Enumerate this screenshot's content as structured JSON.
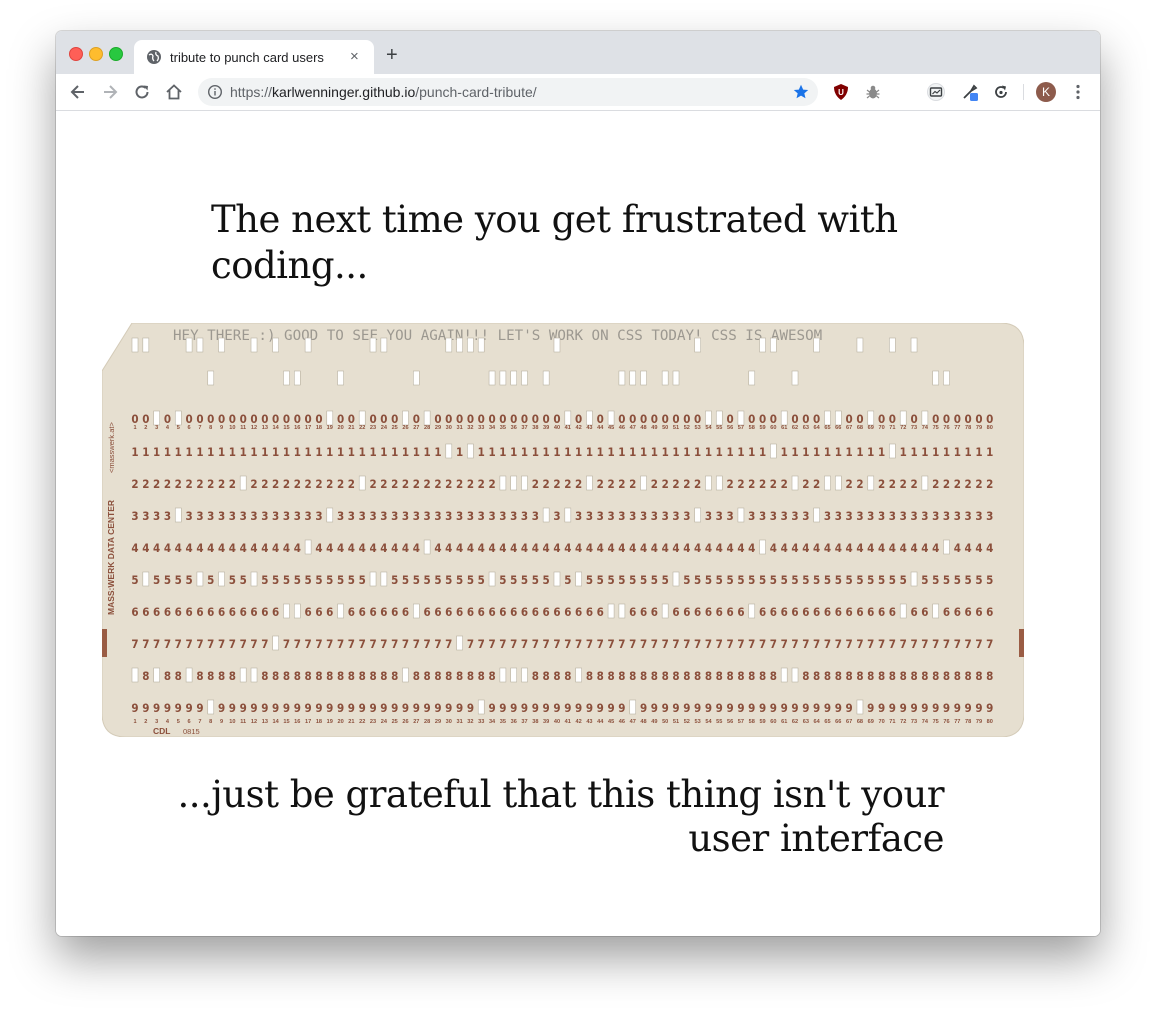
{
  "browser": {
    "tab_title": "tribute to punch card users",
    "tab_close": "×",
    "new_tab": "+",
    "url_scheme": "https://",
    "url_host": "karlwenninger.github.io",
    "url_path": "/punch-card-tribute/",
    "profile_initial": "K",
    "icons": [
      "back-icon",
      "forward-icon",
      "reload-icon",
      "home-icon",
      "site-info-icon",
      "bookmark-star-icon",
      "ublock-icon",
      "bug-extension-icon",
      "cast-icon",
      "eyedropper-extension-icon",
      "refresh-extension-icon",
      "profile-avatar",
      "kebab-menu-icon"
    ]
  },
  "page": {
    "heading_top": "The next time you get frustrated with coding...",
    "heading_bottom": "...just be grateful that this thing isn't your user interface"
  },
  "card": {
    "printed_text": "HEY THERE :) GOOD TO SEE YOU AGAIN!!! LET'S WORK ON CSS TODAY! CSS IS AWESOM",
    "side_label": "MASS:WERK DATA CENTER",
    "side_site": "<masswerk.at>",
    "bottom_code": "CDL",
    "bottom_number": "0815",
    "colors": {
      "card": "#e6dfd0",
      "digits": "#8b4f3b",
      "printed": "#9c9890",
      "hole": "#ffffff"
    }
  }
}
